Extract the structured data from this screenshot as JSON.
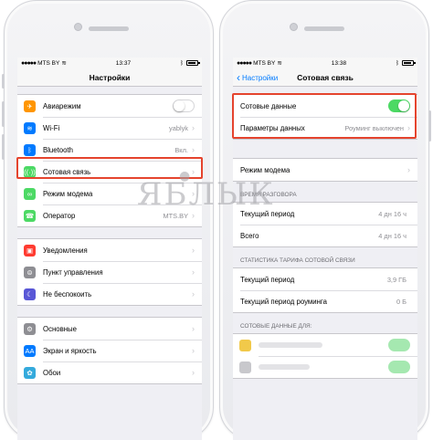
{
  "watermark": "ЯБЛЫК",
  "colors": {
    "ios_blue": "#007aff",
    "toggle_green": "#4cd964",
    "highlight_red": "#e5442e"
  },
  "left_phone": {
    "status": {
      "carrier": "MTS BY",
      "time": "13:37"
    },
    "nav_title": "Настройки",
    "groups": [
      [
        {
          "label": "Авиарежим",
          "icon": "airplane-icon",
          "color": "#ff9500",
          "glyph": "✈",
          "toggle": "off"
        },
        {
          "label": "Wi-Fi",
          "icon": "wifi-icon",
          "color": "#007aff",
          "glyph": "≋",
          "value": "yablyk"
        },
        {
          "label": "Bluetooth",
          "icon": "bluetooth-icon",
          "color": "#007aff",
          "glyph": "ᛒ",
          "value": "Вкл."
        },
        {
          "label": "Сотовая связь",
          "icon": "cellular-icon",
          "color": "#4cd964",
          "glyph": "((·))"
        },
        {
          "label": "Режим модема",
          "icon": "hotspot-icon",
          "color": "#4cd964",
          "glyph": "∞"
        },
        {
          "label": "Оператор",
          "icon": "phone-icon",
          "color": "#4cd964",
          "glyph": "☎",
          "value": "MTS.BY"
        }
      ],
      [
        {
          "label": "Уведомления",
          "icon": "notifications-icon",
          "color": "#ff3b30",
          "glyph": "▣"
        },
        {
          "label": "Пункт управления",
          "icon": "control-center-icon",
          "color": "#8e8e93",
          "glyph": "⊜"
        },
        {
          "label": "Не беспокоить",
          "icon": "moon-icon",
          "color": "#5856d6",
          "glyph": "☾"
        }
      ],
      [
        {
          "label": "Основные",
          "icon": "gear-icon",
          "color": "#8e8e93",
          "glyph": "⚙"
        },
        {
          "label": "Экран и яркость",
          "icon": "display-icon",
          "color": "#007aff",
          "glyph": "AA"
        },
        {
          "label": "Обои",
          "icon": "wallpaper-icon",
          "color": "#34aadc",
          "glyph": "✿"
        }
      ]
    ]
  },
  "right_phone": {
    "status": {
      "carrier": "MTS BY",
      "time": "13:38"
    },
    "nav_back": "Настройки",
    "nav_title": "Сотовая связь",
    "cellular_data_label": "Сотовые данные",
    "data_options_label": "Параметры данных",
    "data_options_value": "Роуминг выключен",
    "modem_label": "Режим модема",
    "call_time_header": "ВРЕМЯ РАЗГОВОРА",
    "current_period_label": "Текущий период",
    "current_period_value": "4 дн 16 ч",
    "total_label": "Всего",
    "total_value": "4 дн 16 ч",
    "stats_header": "СТАТИСТИКА ТАРИФА СОТОВОЙ СВЯЗИ",
    "stat_period_label": "Текущий период",
    "stat_period_value": "3,9 ГБ",
    "stat_roaming_label": "Текущий период роуминга",
    "stat_roaming_value": "0 Б",
    "apps_header": "СОТОВЫЕ ДАННЫЕ ДЛЯ:"
  }
}
